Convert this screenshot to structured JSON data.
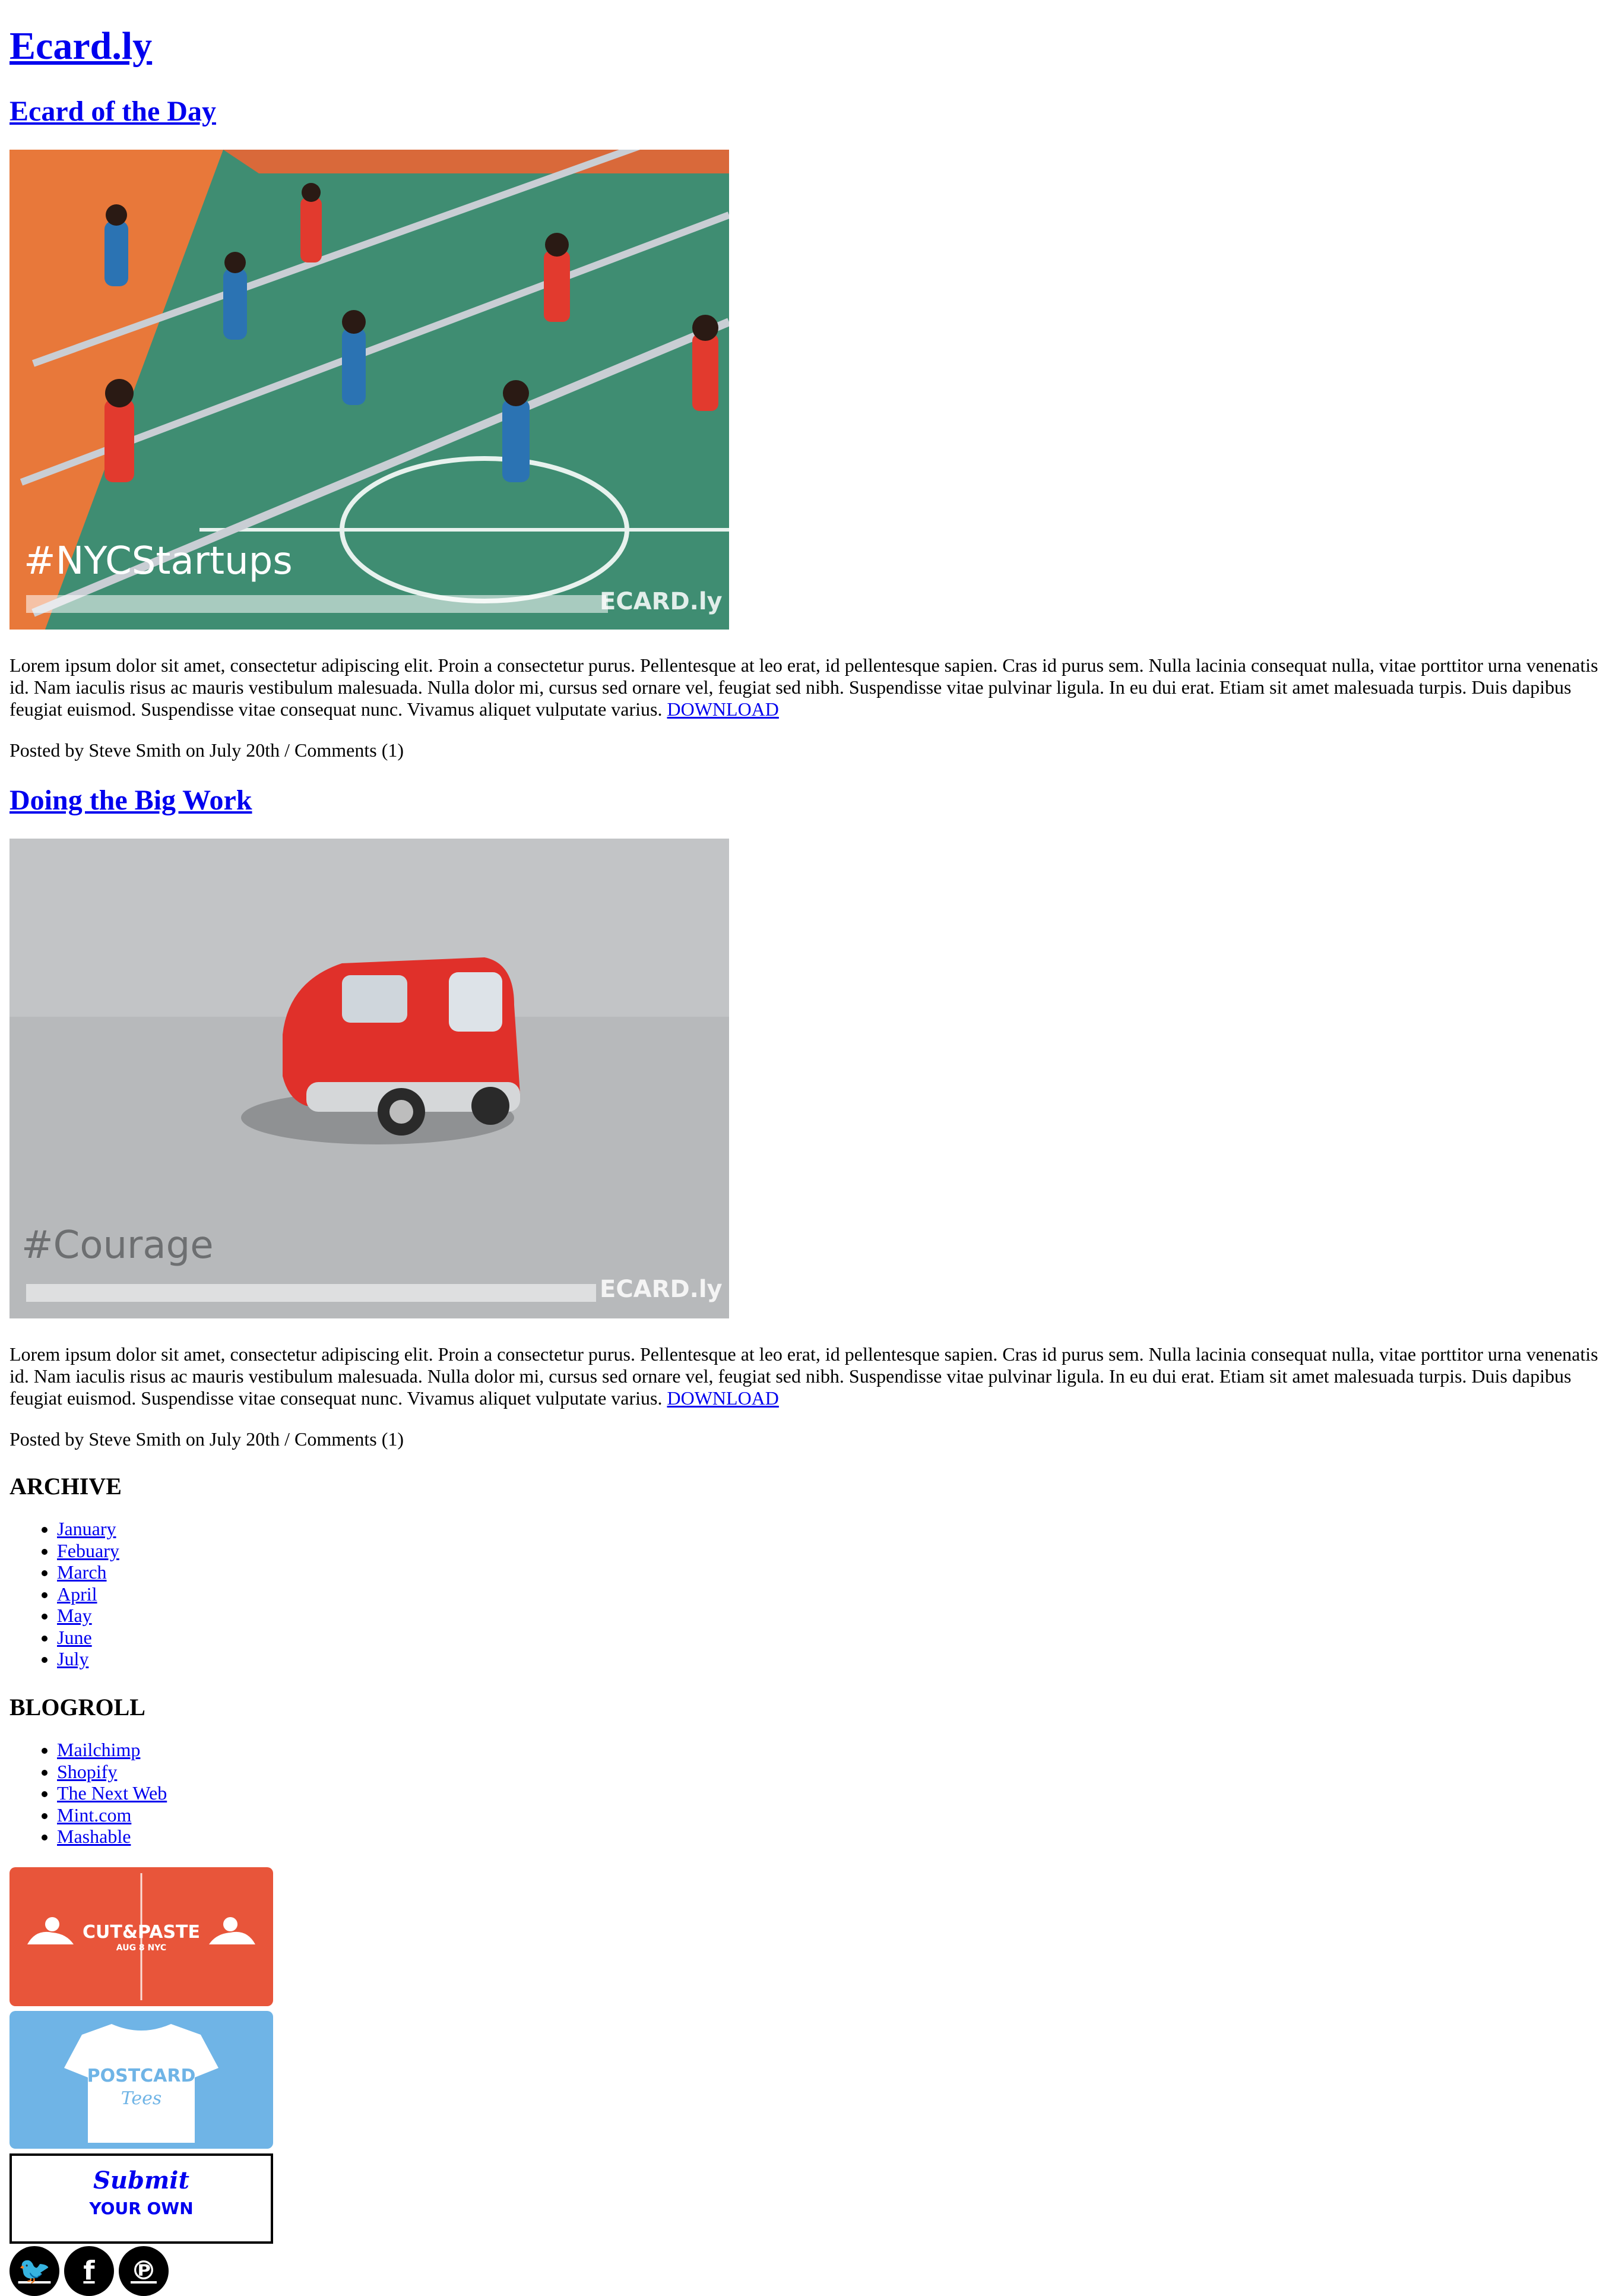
{
  "site": {
    "title": "Ecard.ly"
  },
  "posts": [
    {
      "title": "Ecard of the Day",
      "hashtag": "#NYCStartups",
      "watermark": "ECARD.ly",
      "body": "Lorem ipsum dolor sit amet, consectetur adipiscing elit. Proin a consectetur purus. Pellentesque at leo erat, id pellentesque sapien. Cras id purus sem. Nulla lacinia consequat nulla, vitae porttitor urna venenatis id. Nam iaculis risus ac mauris vestibulum malesuada. Nulla dolor mi, cursus sed ornare vel, feugiat sed nibh. Suspendisse vitae pulvinar ligula. In eu dui erat. Etiam sit amet malesuada turpis. Duis dapibus feugiat euismod. Suspendisse vitae consequat nunc. Vivamus aliquet vulputate varius.",
      "download": "DOWNLOAD",
      "meta": "Posted by Steve Smith on July 20th / Comments (1)"
    },
    {
      "title": "Doing the Big Work",
      "hashtag": "#Courage",
      "watermark": "ECARD.ly",
      "body": "Lorem ipsum dolor sit amet, consectetur adipiscing elit. Proin a consectetur purus. Pellentesque at leo erat, id pellentesque sapien. Cras id purus sem. Nulla lacinia consequat nulla, vitae porttitor urna venenatis id. Nam iaculis risus ac mauris vestibulum malesuada. Nulla dolor mi, cursus sed ornare vel, feugiat sed nibh. Suspendisse vitae pulvinar ligula. In eu dui erat. Etiam sit amet malesuada turpis. Duis dapibus feugiat euismod. Suspendisse vitae consequat nunc. Vivamus aliquet vulputate varius.",
      "download": "DOWNLOAD",
      "meta": "Posted by Steve Smith on July 20th / Comments (1)"
    }
  ],
  "archive": {
    "heading": "ARCHIVE",
    "items": [
      "January",
      "Febuary",
      "March",
      "April",
      "May",
      "June",
      "July"
    ]
  },
  "blogroll": {
    "heading": "BLOGROLL",
    "items": [
      "Mailchimp",
      "Shopify",
      "The Next Web",
      "Mint.com",
      "Mashable"
    ]
  },
  "banners": {
    "cutpaste": {
      "title": "CUT&PASTE",
      "subtitle": "AUG 8 NYC",
      "color": "#E8553A"
    },
    "tees": {
      "line1": "POSTCARD",
      "line2": "Tees",
      "color": "#6FB4E6"
    },
    "submit": {
      "line1": "Submit",
      "line2": "YOUR OWN"
    }
  },
  "social": [
    {
      "icon": "twitter-icon",
      "glyph": "🐦"
    },
    {
      "icon": "facebook-icon",
      "glyph": "f"
    },
    {
      "icon": "pinterest-icon",
      "glyph": "℗"
    }
  ],
  "colors": {
    "link": "#0000EE",
    "text": "#000000",
    "background": "#FFFFFF"
  }
}
